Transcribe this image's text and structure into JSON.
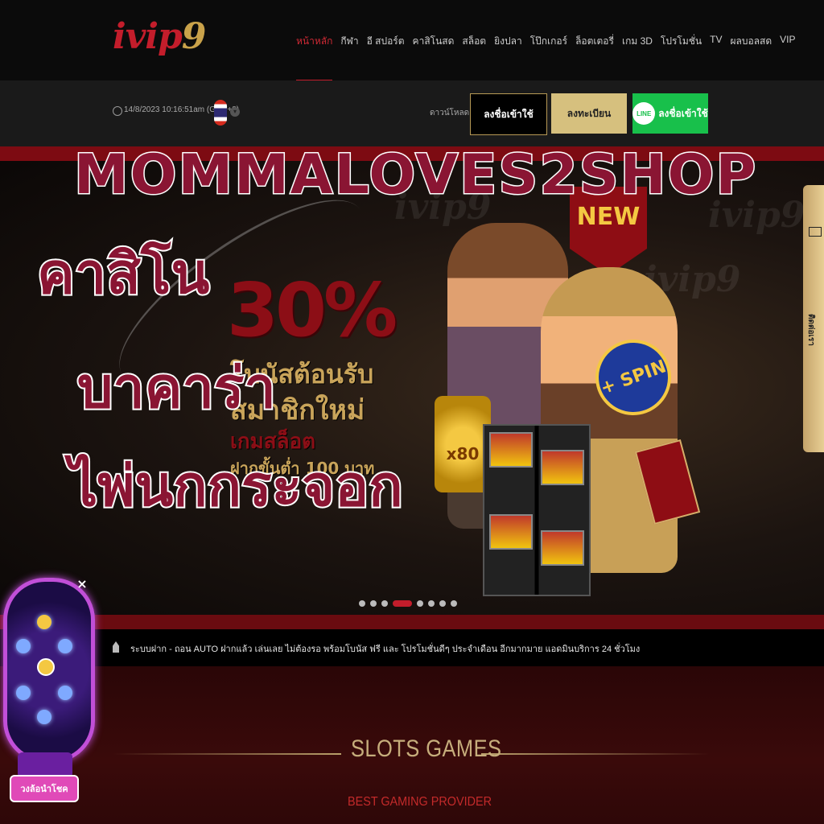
{
  "header": {
    "logo": {
      "prefix": "ivip",
      "suffix": "9"
    },
    "nav": [
      {
        "label": "หน้าหลัก",
        "active": true
      },
      {
        "label": "กีฬา"
      },
      {
        "label": "อี สปอร์ต"
      },
      {
        "label": "คาสิโนสด"
      },
      {
        "label": "สล็อต"
      },
      {
        "label": "ยิงปลา"
      },
      {
        "label": "โป๊กเกอร์"
      },
      {
        "label": "ล็อตเตอรี่"
      },
      {
        "label": "เกม 3D"
      },
      {
        "label": "โปรโมชั่น"
      },
      {
        "label": "TV"
      },
      {
        "label": "ผลบอลสด"
      },
      {
        "label": "VIP"
      }
    ]
  },
  "subbar": {
    "datetime": "14/8/2023 10:16:51am (GMT+8)",
    "language_flag": "thailand-flag",
    "download_label": "ดาวน์โหลด",
    "login_label": "ลงชื่อเข้าใช้",
    "register_label": "ลงทะเบียน",
    "line_badge": "LINE",
    "line_login_label": "ลงชื่อเข้าใช้"
  },
  "banner": {
    "promo_percent": "30%",
    "promo_lines": [
      "โบนัสต้อนรับ",
      "สมาชิกใหม่",
      "เกมสล็อต",
      "ฝากขั้นต่ำ 100 บาท"
    ],
    "new_badge": "NEW",
    "spin_badge": "+ SPIN",
    "multiplier": "x80",
    "watermark": "ivip9",
    "slides_count": 8,
    "active_slide": 3
  },
  "overlay": {
    "title": "MOMMALOVES2SHOP",
    "lines": [
      "คาสิโน",
      "บาคาร่า",
      "ไพ่นกกระจอก"
    ],
    "text_color": "#8a1533",
    "stroke_color": "#ffffff"
  },
  "side_tab": {
    "label": "ติดต่อเรา",
    "icon": "mail-icon"
  },
  "ticker": {
    "icon": "speaker-icon",
    "text": "ระบบฝาก - ถอน AUTO ฝากแล้ว เล่นเลย ไม่ต้องรอ พร้อมโบนัส ฟรี และ โปรโมชั่นดีๆ ประจำเดือน อีกมากมาย แอดมินบริการ 24 ชั่วโมง"
  },
  "section": {
    "title": "SLOTS GAMES",
    "subtitle": "BEST GAMING PROVIDER"
  },
  "wheel": {
    "button_label": "วงล้อนำโชค",
    "close_label": "×"
  },
  "colors": {
    "accent_red": "#c31d2b",
    "gold": "#d6c07e",
    "line_green": "#18c04b",
    "overlay_text": "#8a1533"
  }
}
